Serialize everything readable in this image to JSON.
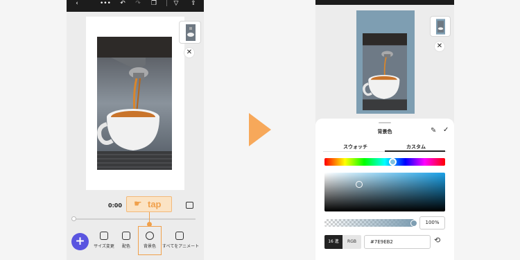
{
  "left_screen": {
    "time": "0:00",
    "tap_label": "tap",
    "close_glyph": "✕",
    "add_glyph": "+",
    "tools": [
      {
        "icon": "resize-icon",
        "label": "サイズ変更"
      },
      {
        "icon": "palette-icon",
        "label": "配色"
      },
      {
        "icon": "circle-icon",
        "label": "背景色"
      },
      {
        "icon": "animate-icon",
        "label": "すべてをアニメート"
      }
    ]
  },
  "right_screen": {
    "close_glyph": "✕",
    "sheet_title": "背景色",
    "tabs": [
      "スウォッチ",
      "カスタム"
    ],
    "active_tab": "カスタム",
    "opacity_value": "100%",
    "mode_hex": "16 進",
    "mode_rgb": "RGB",
    "hex_value": "#7E9EB2"
  },
  "colors": {
    "accent": "#5a55e0",
    "highlight": "#f0a04b",
    "background_color": "#7e9eb2"
  }
}
